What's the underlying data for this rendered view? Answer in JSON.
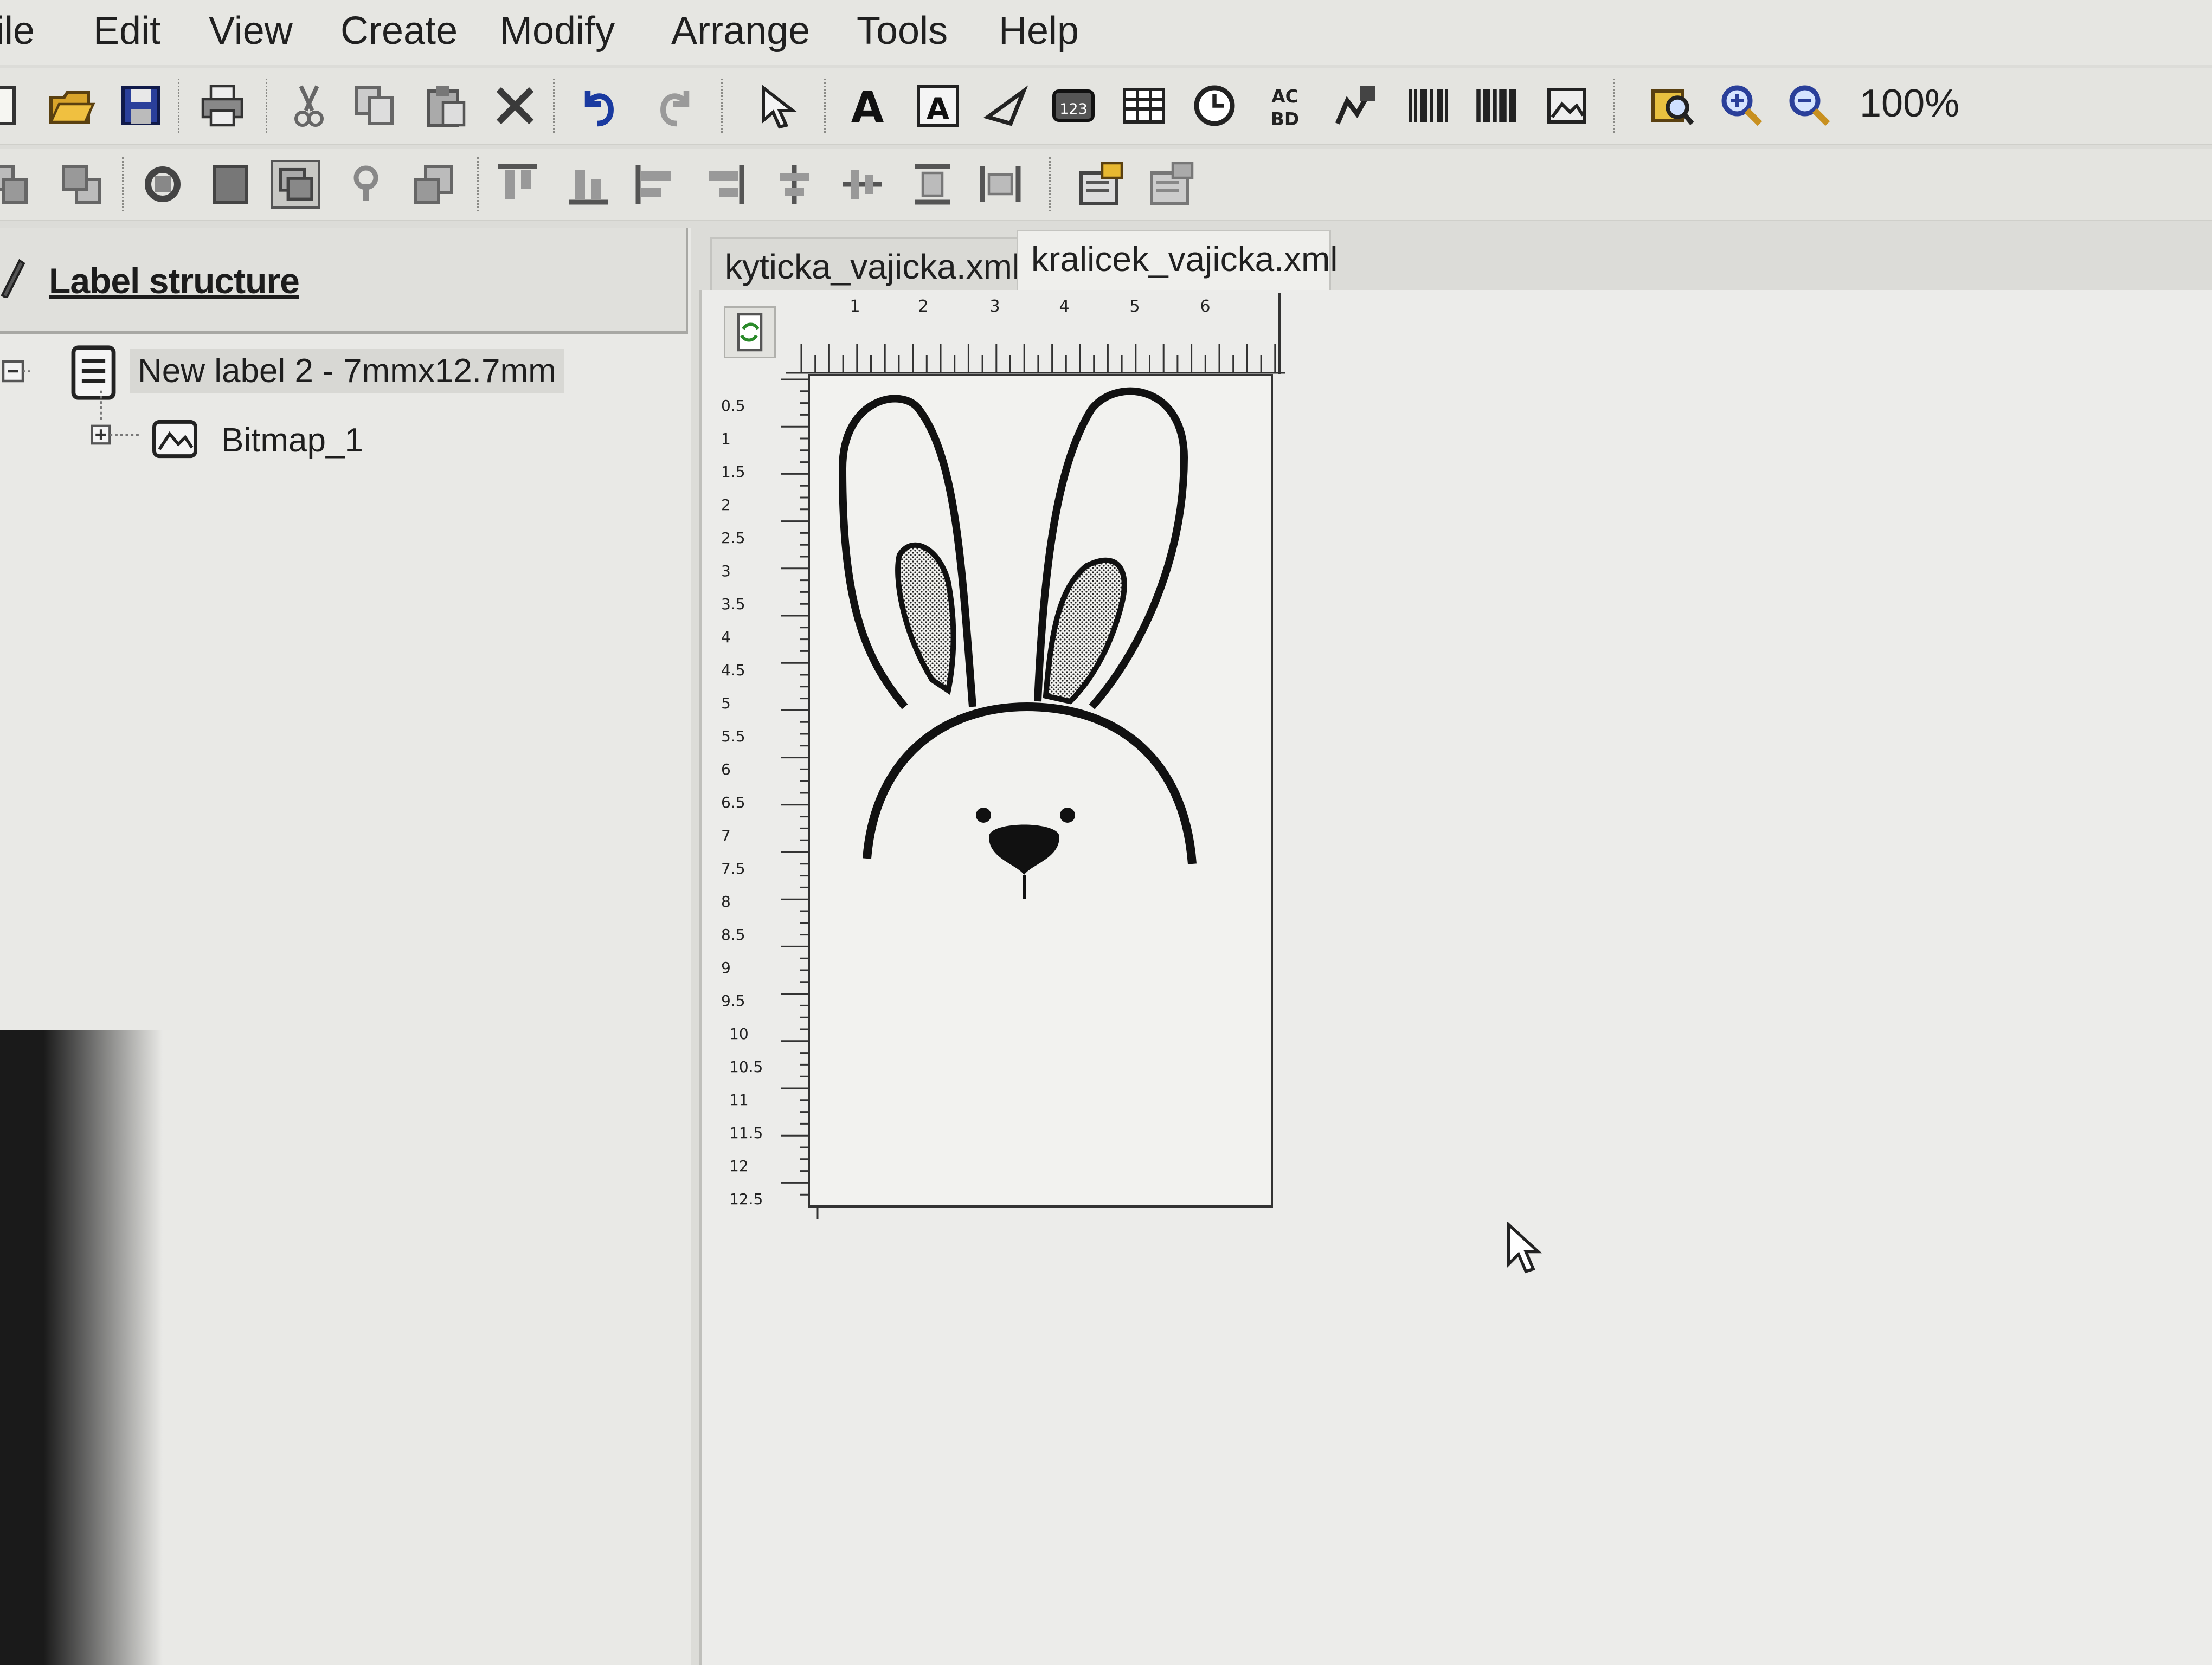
{
  "menu": [
    "ile",
    "Edit",
    "View",
    "Create",
    "Modify",
    "Arrange",
    "Tools",
    "Help"
  ],
  "toolbar": {
    "zoom_level": "100%",
    "row1_icons": [
      "new-icon",
      "open-icon",
      "save-icon",
      "print-icon",
      "cut-icon",
      "copy-icon",
      "paste-icon",
      "delete-icon",
      "undo-icon",
      "redo-icon",
      "select-arrow-icon",
      "text-icon",
      "rich-text-icon",
      "line-icon",
      "counter-icon",
      "table-icon",
      "clock-icon",
      "variable-text-icon",
      "picture-edit-icon",
      "barcode-icon",
      "barcode2-icon",
      "image-icon",
      "preview-icon",
      "zoom-in-icon",
      "zoom-out-icon"
    ],
    "row2_icons": [
      "send-back-icon",
      "bring-front-icon",
      "rotate-icon",
      "fill-icon",
      "group-icon",
      "lock-icon",
      "ungroup-icon",
      "align-top-icon",
      "align-bottom-icon",
      "align-left-icon",
      "align-right-icon",
      "center-vertical-icon",
      "center-horizontal-icon",
      "distribute-vertical-icon",
      "distribute-horizontal-icon",
      "properties-icon",
      "properties2-icon"
    ]
  },
  "panel": {
    "title": "Label structure",
    "tree": {
      "root": "New label 2 - 7mmx12.7mm",
      "child": "Bitmap_1"
    }
  },
  "tabs": [
    "kyticka_vajicka.xml",
    "kralicek_vajicka.xml"
  ],
  "active_tab": 1,
  "rulers": {
    "horizontal": [
      "1",
      "2",
      "3",
      "4",
      "5",
      "6"
    ],
    "vertical": [
      "0.5",
      "1",
      "1.5",
      "2",
      "2.5",
      "3",
      "3.5",
      "4",
      "4.5",
      "5",
      "5.5",
      "6",
      "6.5",
      "7",
      "7.5",
      "8",
      "8.5",
      "9",
      "9.5",
      "10",
      "10.5",
      "11",
      "11.5",
      "12",
      "12.5"
    ]
  },
  "canvas": {
    "label_width_mm": 7,
    "label_height_mm": 12.7,
    "bitmap_subject": "bunny-head-drawing"
  }
}
